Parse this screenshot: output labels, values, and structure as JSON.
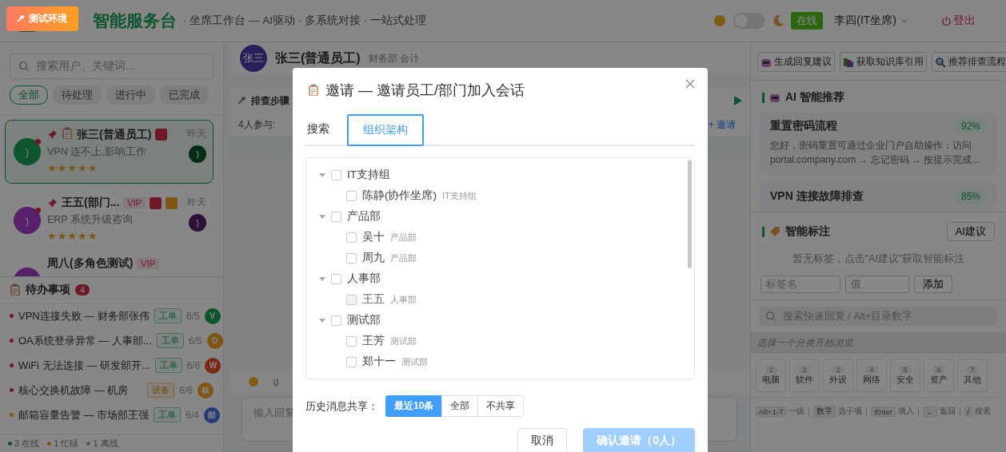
{
  "env_badge": "测试环境",
  "header": {
    "title": "智能服务台",
    "subtitle": "· 坐席工作台 — AI驱动 · 多系统对接 · 一站式处理",
    "dark_mode": false,
    "status": "在线",
    "user": "李四(IT坐席)",
    "logout": "登出"
  },
  "sidebar": {
    "search_placeholder": "搜索用户、关键词...",
    "filters": [
      {
        "label": "全部",
        "selected": true
      },
      {
        "label": "待处理",
        "selected": false
      },
      {
        "label": "进行中",
        "selected": false
      },
      {
        "label": "已完成",
        "selected": false
      }
    ],
    "conversations": [
      {
        "name": "张三(普通员工)",
        "avatar": ")",
        "color": "#0d552f",
        "pinned": true,
        "ticket": true,
        "preview": "VPN 连不上,影响工作",
        "time": "昨天",
        "stars": 5,
        "unread": true,
        "selected": true
      },
      {
        "name": "王五(部门...",
        "avatar": ")",
        "color": "#56206a",
        "pinned": true,
        "vip": "VIP",
        "preview": "ERP 系统升级咨询",
        "time": "昨天",
        "stars": 5,
        "unread": true,
        "selected": false
      },
      {
        "name": "周八(多角色测试)",
        "color": "#56206a",
        "vip": "VIP",
        "selected": false
      }
    ],
    "todo": {
      "title": "待办事项",
      "count": "4",
      "items": [
        {
          "title": "VPN连接失败 — 财务部张伟",
          "urgent": true,
          "tag": "工单",
          "kind": "ticket",
          "date": "6/5",
          "avatar": "V",
          "color": "#0d552f"
        },
        {
          "title": "OA系统登录异常 — 人事部...",
          "urgent": true,
          "tag": "工单",
          "kind": "ticket",
          "date": "6/5",
          "avatar": "O",
          "color": "#7f5511"
        },
        {
          "title": "WiFi 无法连接 — 研发部开...",
          "urgent": true,
          "tag": "工单",
          "kind": "ticket",
          "date": "6/6",
          "avatar": "W",
          "color": "#7b2a16"
        },
        {
          "title": "核心交换机故障 — 机房",
          "urgent": true,
          "tag": "设备",
          "kind": "device",
          "date": "6/6",
          "avatar": "核",
          "color": "#7f5511"
        },
        {
          "title": "邮箱容量告警 — 市场部王强",
          "urgent": false,
          "tag": "工单",
          "kind": "ticket",
          "date": "6/4",
          "avatar": "邮",
          "color": "#273a77"
        }
      ]
    },
    "presence": [
      {
        "label": "3 在线",
        "color": "#0d552f"
      },
      {
        "label": "1 忙碌",
        "color": "#7f5511"
      },
      {
        "label": "1 离线",
        "color": "#5a5a5a"
      }
    ]
  },
  "chat": {
    "avatar": "张三",
    "name": "张三(普通员工)",
    "dept": "财务部 会计",
    "steps_title": "排查步骤",
    "participants_label": "4人参与:",
    "invite_link": "+ 邀请",
    "input_placeholder": "输入回复"
  },
  "right": {
    "actions": [
      {
        "label": "生成回复建议",
        "kind": "robot"
      },
      {
        "label": "获取知识库引用",
        "kind": "books"
      },
      {
        "label": "推荐排查流程",
        "kind": "search"
      }
    ],
    "ai_title": "AI 智能推荐",
    "recommendations": [
      {
        "title": "重置密码流程",
        "score": "92%",
        "text": "您好，密码重置可通过企业门户自助操作：访问 portal.company.com → 忘记密码 → 按提示完成..."
      },
      {
        "title": "VPN 连接故障排查",
        "score": "85%"
      }
    ],
    "tags": {
      "title": "智能标注",
      "ai_button": "AI建议",
      "empty": "暂无标签，点击\"AI建议\"获取智能标注",
      "name_placeholder": "标签名",
      "value_placeholder": "值",
      "add": "添加"
    },
    "quick": {
      "search_placeholder": "搜索快速回复 / Alt+目录数字",
      "hint": "选择一个分类开始浏览",
      "categories": [
        {
          "key": "1",
          "label": "电脑"
        },
        {
          "key": "2",
          "label": "软件"
        },
        {
          "key": "3",
          "label": "外设"
        },
        {
          "key": "4",
          "label": "网络"
        },
        {
          "key": "5",
          "label": "安全"
        },
        {
          "key": "6",
          "label": "资产"
        },
        {
          "key": "7",
          "label": "其他"
        }
      ],
      "shortcuts": [
        {
          "key": "Alt+1-7",
          "label": "一级"
        },
        {
          "key": "数字",
          "label": "选子项"
        },
        {
          "key": "Enter",
          "label": "填入"
        },
        {
          "key": "←",
          "label": "返回"
        },
        {
          "key": "/",
          "label": "搜索"
        }
      ]
    }
  },
  "modal": {
    "title": "邀请 — 邀请员工/部门加入会话",
    "tabs": [
      {
        "label": "搜索",
        "selected": false
      },
      {
        "label": "组织架构",
        "selected": true
      }
    ],
    "tree": [
      {
        "label": "IT支持组",
        "expanded": true,
        "checked": false,
        "children": [
          {
            "label": "陈静(协作坐席)",
            "dept": "IT支持组",
            "checked": false,
            "disabled": false
          }
        ]
      },
      {
        "label": "产品部",
        "expanded": true,
        "checked": false,
        "children": [
          {
            "label": "吴十",
            "dept": "产品部",
            "checked": false,
            "disabled": false
          },
          {
            "label": "周九",
            "dept": "产品部",
            "checked": false,
            "disabled": false
          }
        ]
      },
      {
        "label": "人事部",
        "expanded": true,
        "checked": false,
        "children": [
          {
            "label": "王五",
            "dept": "人事部",
            "checked": false,
            "disabled": true
          }
        ]
      },
      {
        "label": "测试部",
        "expanded": true,
        "checked": false,
        "children": [
          {
            "label": "王芳",
            "dept": "测试部",
            "checked": false,
            "disabled": false
          },
          {
            "label": "郑十一",
            "dept": "测试部",
            "checked": false,
            "disabled": false
          }
        ]
      }
    ],
    "history_label": "历史消息共享：",
    "history_options": [
      {
        "label": "最近10条",
        "selected": true
      },
      {
        "label": "全部",
        "selected": false
      },
      {
        "label": "不共享",
        "selected": false
      }
    ],
    "cancel": "取消",
    "confirm": "确认邀请（0人）",
    "confirm_disabled": true
  }
}
